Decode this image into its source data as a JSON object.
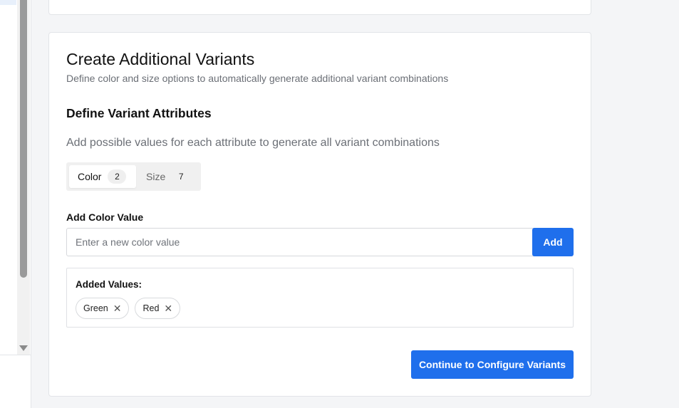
{
  "variants_card": {
    "title": "Create Additional Variants",
    "subtitle": "Define color and size options to automatically generate additional variant combinations",
    "section_title": "Define Variant Attributes",
    "section_help": "Add possible values for each attribute to generate all variant combinations",
    "tabs": [
      {
        "label": "Color",
        "count": "2",
        "active": true
      },
      {
        "label": "Size",
        "count": "7",
        "active": false
      }
    ],
    "field_label": "Add Color Value",
    "input": {
      "placeholder": "Enter a new color value",
      "value": ""
    },
    "add_button": "Add",
    "added_values_label": "Added Values:",
    "values": [
      {
        "label": "Green",
        "remove_icon": "close-icon"
      },
      {
        "label": "Red",
        "remove_icon": "close-icon"
      }
    ],
    "remove_glyph": "✕",
    "continue_button": "Continue to Configure Variants"
  },
  "colors": {
    "accent": "#1f6fec",
    "background": "#f4f5f7"
  }
}
